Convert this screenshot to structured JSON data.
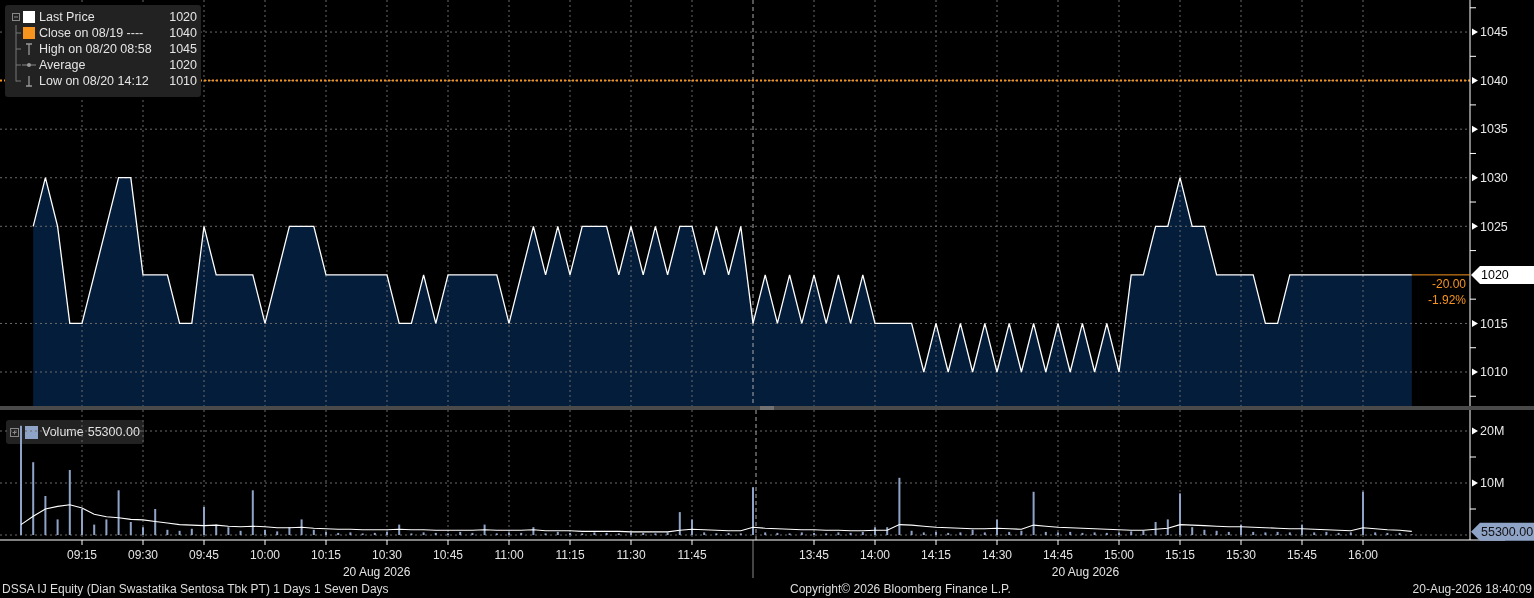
{
  "legend": [
    {
      "value": "1020",
      "kind": "square",
      "color": "#ffffff"
    },
    {
      "label": "Close on 08/19 ----",
      "value": "1040",
      "kind": "square",
      "color": "#f7941d"
    },
    {
      "label": "High on 08/20 08:58",
      "value": "1045",
      "kind": "high"
    },
    {
      "label": "Average",
      "value": "1020",
      "kind": "average"
    },
    {
      "label": "Low on 08/20 14:12",
      "value": "1010",
      "kind": "low"
    }
  ],
  "price_chart": {
    "chart_data": {
      "type": "area",
      "grid": true,
      "ylim": [
        1006.5,
        1048.3
      ],
      "series": [
        {
          "name": "Last Price",
          "color": "#ffffff",
          "values": [
            null,
            1025,
            1030,
            1025,
            1015,
            1015,
            1020,
            1025,
            1030,
            1030,
            1020,
            1020,
            1020,
            1015,
            1015,
            1025,
            1020,
            1020,
            1020,
            1020,
            1015,
            1020,
            1025,
            1025,
            1025,
            1020,
            1020,
            1020,
            1020,
            1020,
            1020,
            1015,
            1015,
            1020,
            1015,
            1020,
            1020,
            1020,
            1020,
            1020,
            1015,
            1020,
            1025,
            1020,
            1025,
            1020,
            1025,
            1025,
            1025,
            1020,
            1025,
            1020,
            1025,
            1020,
            1025,
            1025,
            1020,
            1025,
            1020,
            1025,
            1015,
            1020,
            1015,
            1020,
            1015,
            1020,
            1015,
            1020,
            1015,
            1020,
            1015,
            1015,
            1015,
            1015,
            1010,
            1015,
            1010,
            1015,
            1010,
            1015,
            1010,
            1015,
            1010,
            1015,
            1010,
            1015,
            1010,
            1015,
            1010,
            1015,
            1010,
            1020,
            1020,
            1025,
            1025,
            1030,
            1025,
            1025,
            1020,
            1020,
            1020,
            1020,
            1015,
            1015,
            1020,
            1020,
            1020,
            1020,
            1020,
            1020,
            1020,
            1020,
            1020,
            1020,
            1020
          ]
        }
      ],
      "yticks": [
        1010,
        1015,
        1025,
        1030,
        1035,
        1040,
        1045
      ],
      "ref_lines": [
        {
          "axis": "y",
          "value": 1040,
          "color": "#f7941d"
        }
      ]
    },
    "last_tag": {
      "value": "1020",
      "change": "-20.00",
      "change_pct": "-1.92%"
    }
  },
  "volume_chart": {
    "legend": {
      "value": "55300.00",
      "color": "#8fa3c7"
    },
    "chart_data": {
      "type": "bar",
      "grid": true,
      "ylim": [
        -960000,
        24040000
      ],
      "categories": [
        null,
        null,
        null,
        null,
        null,
        "09:15",
        null,
        null,
        null,
        null,
        "09:30",
        null,
        null,
        null,
        null,
        "09:45",
        null,
        null,
        null,
        null,
        "10:00",
        null,
        null,
        null,
        null,
        "10:15",
        null,
        null,
        null,
        null,
        "10:30",
        null,
        null,
        null,
        null,
        "10:45",
        null,
        null,
        null,
        null,
        "11:00",
        null,
        null,
        null,
        null,
        "11:15",
        null,
        null,
        null,
        null,
        "11:30",
        null,
        null,
        null,
        null,
        "11:45",
        null,
        null,
        null,
        null,
        null,
        null,
        null,
        null,
        null,
        "13:45",
        null,
        null,
        null,
        null,
        "14:00",
        null,
        null,
        null,
        null,
        "14:15",
        null,
        null,
        null,
        null,
        "14:30",
        null,
        null,
        null,
        null,
        "14:45",
        null,
        null,
        null,
        null,
        "15:00",
        null,
        null,
        null,
        null,
        "15:15",
        null,
        null,
        null,
        null,
        "15:30",
        null,
        null,
        null,
        null,
        "15:45",
        null,
        null,
        null,
        null,
        "16:00",
        null,
        null,
        null,
        null
      ],
      "series": [
        {
          "name": "Volume",
          "color": "#8fa3c7",
          "values": [
            21000000,
            14000000,
            7500000,
            3000000,
            12500000,
            5000000,
            2000000,
            3000000,
            8600000,
            2500000,
            1500000,
            5000000,
            1000000,
            800000,
            1200000,
            5400000,
            2000000,
            1500000,
            800000,
            8600000,
            1000000,
            700000,
            1500000,
            3000000,
            1000000,
            600000,
            400000,
            500000,
            300000,
            400000,
            600000,
            2000000,
            300000,
            500000,
            400000,
            300000,
            600000,
            400000,
            2000000,
            300000,
            500000,
            400000,
            1500000,
            300000,
            600000,
            400000,
            300000,
            500000,
            400000,
            300000,
            500000,
            400000,
            300000,
            500000,
            4400000,
            3000000,
            500000,
            300000,
            400000,
            300000,
            9200000,
            500000,
            400000,
            300000,
            500000,
            400000,
            300000,
            500000,
            400000,
            600000,
            1500000,
            1500000,
            11000000,
            800000,
            500000,
            600000,
            400000,
            500000,
            1000000,
            500000,
            3000000,
            600000,
            800000,
            8300000,
            600000,
            500000,
            600000,
            400000,
            500000,
            400000,
            500000,
            700000,
            800000,
            2500000,
            3000000,
            8000000,
            1500000,
            1000000,
            800000,
            600000,
            2000000,
            600000,
            500000,
            600000,
            500000,
            2000000,
            500000,
            600000,
            400000,
            500000,
            8300000,
            500000,
            400000,
            400000,
            55300
          ]
        },
        {
          "type": "line",
          "color": "#ffffff",
          "values": [
            2000000,
            3600000,
            5000000,
            5500000,
            5800000,
            5200000,
            4000000,
            3500000,
            3300000,
            3000000,
            2900000,
            2600000,
            2300000,
            2000000,
            1900000,
            1800000,
            1900000,
            1700000,
            1600000,
            1700000,
            1600000,
            1400000,
            1400000,
            1500000,
            1300000,
            1200000,
            1100000,
            1100000,
            1000000,
            1000000,
            1000000,
            1100000,
            1000000,
            1000000,
            900000,
            900000,
            900000,
            900000,
            1000000,
            900000,
            900000,
            900000,
            1000000,
            800000,
            800000,
            800000,
            700000,
            700000,
            700000,
            700000,
            600000,
            600000,
            600000,
            600000,
            900000,
            1100000,
            1000000,
            900000,
            800000,
            800000,
            1500000,
            1300000,
            1200000,
            1100000,
            1000000,
            1000000,
            900000,
            900000,
            800000,
            800000,
            900000,
            900000,
            2000000,
            1900000,
            1700000,
            1500000,
            1400000,
            1300000,
            1200000,
            1200000,
            1300000,
            1200000,
            1100000,
            1900000,
            1700000,
            1500000,
            1400000,
            1300000,
            1200000,
            1100000,
            1000000,
            900000,
            900000,
            1100000,
            1300000,
            2000000,
            1900000,
            1800000,
            1700000,
            1600000,
            1600000,
            1500000,
            1400000,
            1300000,
            1200000,
            1200000,
            1100000,
            1000000,
            900000,
            800000,
            1400000,
            1200000,
            1000000,
            900000,
            700000
          ]
        }
      ],
      "yticks": [
        {
          "value": 10000000,
          "label": "10M"
        },
        {
          "value": 20000000,
          "label": "20M"
        }
      ],
      "annotations": [
        "20 Aug 2026",
        "20 Aug 2026"
      ]
    },
    "last_tag": "55300.00"
  },
  "footer": {
    "security": "DSSA IJ Equity (Dian Swastatika Sentosa Tbk PT) 1 Days 1 Seven Days",
    "copyright": "Copyright© 2026 Bloomberg Finance L.P.",
    "timestamp": "20-Aug-2026 18:40:09"
  }
}
